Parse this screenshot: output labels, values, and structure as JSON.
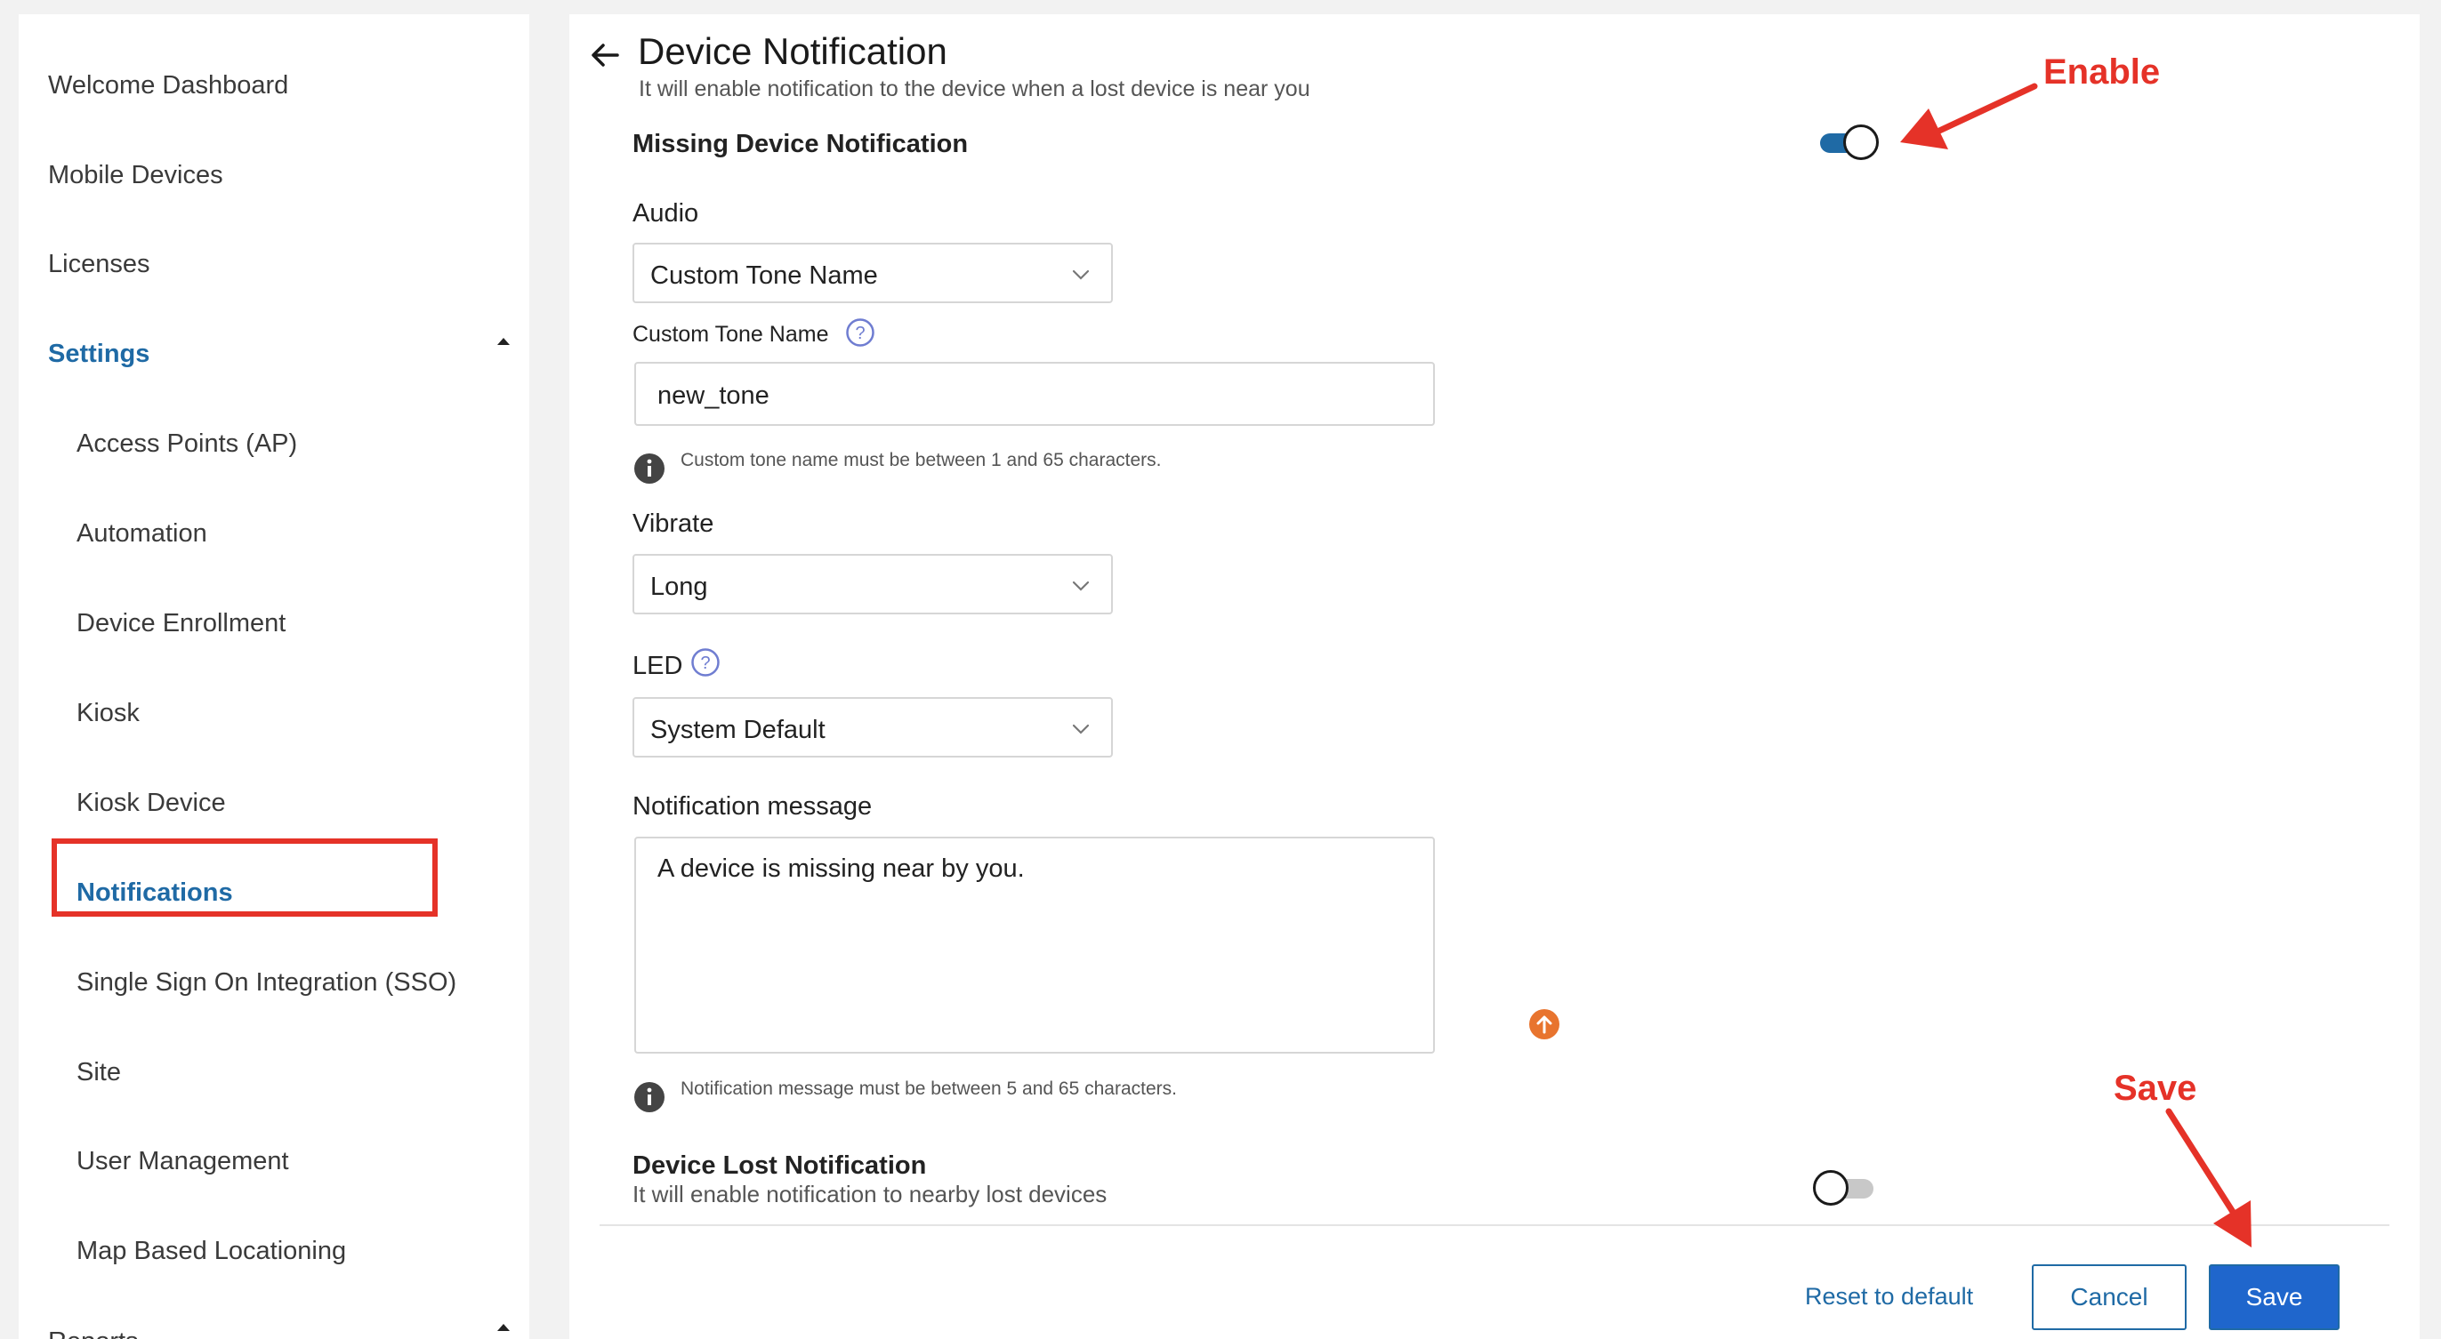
{
  "sidebar": {
    "items": [
      {
        "label": "Welcome Dashboard"
      },
      {
        "label": "Mobile Devices"
      },
      {
        "label": "Licenses"
      },
      {
        "label": "Settings"
      },
      {
        "label": "Access Points (AP)"
      },
      {
        "label": "Automation"
      },
      {
        "label": "Device Enrollment"
      },
      {
        "label": "Kiosk"
      },
      {
        "label": "Kiosk Device"
      },
      {
        "label": "Notifications"
      },
      {
        "label": "Single Sign On Integration (SSO)"
      },
      {
        "label": "Site"
      },
      {
        "label": "User Management"
      },
      {
        "label": "Map Based Locationing"
      },
      {
        "label": "Reports"
      }
    ],
    "active": "Notifications"
  },
  "page": {
    "title": "Device Notification",
    "subtitle": "It will enable notification to the device when a lost device is near you"
  },
  "missing_notification": {
    "label": "Missing Device Notification",
    "enabled": true
  },
  "audio": {
    "label": "Audio",
    "value": "Custom Tone Name"
  },
  "custom_tone": {
    "label": "Custom Tone Name",
    "value": "new_tone",
    "hint": "Custom tone name must be between 1 and 65 characters."
  },
  "vibrate": {
    "label": "Vibrate",
    "value": "Long"
  },
  "led": {
    "label": "LED",
    "value": "System Default"
  },
  "message": {
    "label": "Notification message",
    "value": "A device is missing near by you.",
    "hint": "Notification message must be between 5 and 65 characters."
  },
  "lost_notification": {
    "label": "Device Lost Notification",
    "description": "It will enable notification to nearby lost devices",
    "enabled": false
  },
  "footer": {
    "reset_label": "Reset to default",
    "cancel_label": "Cancel",
    "save_label": "Save"
  },
  "annotations": {
    "enable_label": "Enable",
    "save_label": "Save"
  },
  "colors": {
    "accent": "#1f6aa5",
    "primary_button": "#1f66cc",
    "annotation": "#e53228",
    "upload_icon": "#e8742e"
  }
}
